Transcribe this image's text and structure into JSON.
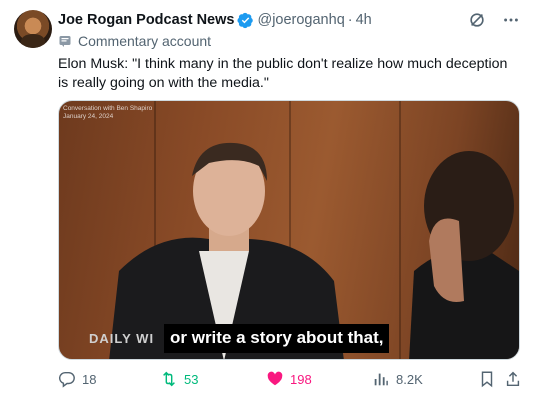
{
  "post": {
    "author_name": "Joe Rogan Podcast News",
    "handle": "@joeroganhq",
    "separator": "·",
    "time": "4h",
    "label": "Commentary account",
    "text": "Elon Musk: \"I think many in the public don't realize how much deception is really going on with the media.\""
  },
  "media": {
    "overlay_line1": "Conversation with Ben Shapiro",
    "overlay_line2": "January 24, 2024",
    "brand": "DAILY WI",
    "caption": "or write a story about that,"
  },
  "actions": {
    "reply_count": "18",
    "repost_count": "53",
    "like_count": "198",
    "views_count": "8.2K"
  },
  "colors": {
    "text_primary": "#0f1419",
    "text_secondary": "#536471",
    "verified": "#1d9bf0",
    "repost": "#00ba7c",
    "like": "#f91880"
  },
  "icons": {
    "verified": "verified-badge-icon",
    "grok": "grok-icon",
    "more": "more-icon",
    "label": "commentary-badge-icon",
    "reply": "reply-icon",
    "repost": "repost-icon",
    "like": "heart-icon",
    "views": "views-icon",
    "bookmark": "bookmark-icon",
    "share": "share-icon"
  }
}
